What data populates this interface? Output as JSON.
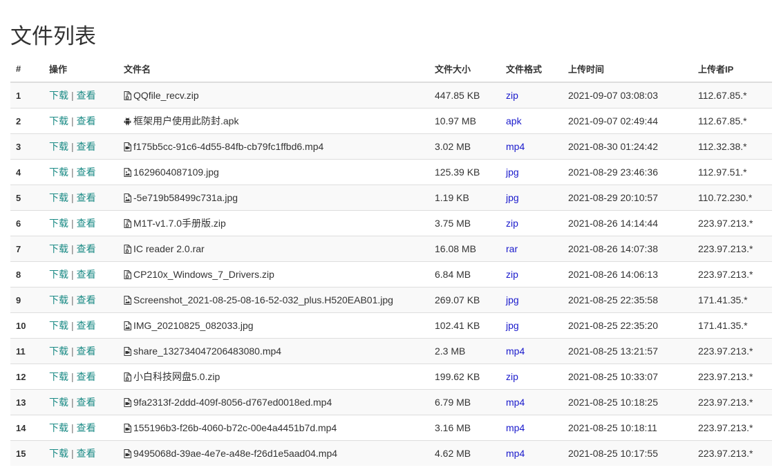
{
  "page_title": "文件列表",
  "columns": [
    "#",
    "操作",
    "文件名",
    "文件大小",
    "文件格式",
    "上传时间",
    "上传者IP"
  ],
  "actions": {
    "download": "下载",
    "view": "查看",
    "separator": "|"
  },
  "rows": [
    {
      "idx": "1",
      "icon": "zip-file-icon",
      "name": "QQfile_recv.zip",
      "size": "447.85 KB",
      "format": "zip",
      "time": "2021-09-07 03:08:03",
      "ip": "112.67.85.*"
    },
    {
      "idx": "2",
      "icon": "android-icon",
      "name": "框架用户使用此防封.apk",
      "size": "10.97 MB",
      "format": "apk",
      "time": "2021-09-07 02:49:44",
      "ip": "112.67.85.*"
    },
    {
      "idx": "3",
      "icon": "video-file-icon",
      "name": "f175b5cc-91c6-4d55-84fb-cb79fc1ffbd6.mp4",
      "size": "3.02 MB",
      "format": "mp4",
      "time": "2021-08-30 01:24:42",
      "ip": "112.32.38.*"
    },
    {
      "idx": "4",
      "icon": "image-file-icon",
      "name": "1629604087109.jpg",
      "size": "125.39 KB",
      "format": "jpg",
      "time": "2021-08-29 23:46:36",
      "ip": "112.97.51.*"
    },
    {
      "idx": "5",
      "icon": "image-file-icon",
      "name": "-5e719b58499c731a.jpg",
      "size": "1.19 KB",
      "format": "jpg",
      "time": "2021-08-29 20:10:57",
      "ip": "110.72.230.*"
    },
    {
      "idx": "6",
      "icon": "zip-file-icon",
      "name": "M1T-v1.7.0手册版.zip",
      "size": "3.75 MB",
      "format": "zip",
      "time": "2021-08-26 14:14:44",
      "ip": "223.97.213.*"
    },
    {
      "idx": "7",
      "icon": "zip-file-icon",
      "name": "IC reader 2.0.rar",
      "size": "16.08 MB",
      "format": "rar",
      "time": "2021-08-26 14:07:38",
      "ip": "223.97.213.*"
    },
    {
      "idx": "8",
      "icon": "zip-file-icon",
      "name": "CP210x_Windows_7_Drivers.zip",
      "size": "6.84 MB",
      "format": "zip",
      "time": "2021-08-26 14:06:13",
      "ip": "223.97.213.*"
    },
    {
      "idx": "9",
      "icon": "image-file-icon",
      "name": "Screenshot_2021-08-25-08-16-52-032_plus.H520EAB01.jpg",
      "size": "269.07 KB",
      "format": "jpg",
      "time": "2021-08-25 22:35:58",
      "ip": "171.41.35.*"
    },
    {
      "idx": "10",
      "icon": "image-file-icon",
      "name": "IMG_20210825_082033.jpg",
      "size": "102.41 KB",
      "format": "jpg",
      "time": "2021-08-25 22:35:20",
      "ip": "171.41.35.*"
    },
    {
      "idx": "11",
      "icon": "video-file-icon",
      "name": "share_132734047206483080.mp4",
      "size": "2.3 MB",
      "format": "mp4",
      "time": "2021-08-25 13:21:57",
      "ip": "223.97.213.*"
    },
    {
      "idx": "12",
      "icon": "zip-file-icon",
      "name": "小白科技网盘5.0.zip",
      "size": "199.62 KB",
      "format": "zip",
      "time": "2021-08-25 10:33:07",
      "ip": "223.97.213.*"
    },
    {
      "idx": "13",
      "icon": "video-file-icon",
      "name": "9fa2313f-2ddd-409f-8056-d767ed0018ed.mp4",
      "size": "6.79 MB",
      "format": "mp4",
      "time": "2021-08-25 10:18:25",
      "ip": "223.97.213.*"
    },
    {
      "idx": "14",
      "icon": "video-file-icon",
      "name": "155196b3-f26b-4060-b72c-00e4a4451b7d.mp4",
      "size": "3.16 MB",
      "format": "mp4",
      "time": "2021-08-25 10:18:11",
      "ip": "223.97.213.*"
    },
    {
      "idx": "15",
      "icon": "video-file-icon",
      "name": "9495068d-39ae-4e7e-a48e-f26d1e5aad04.mp4",
      "size": "4.62 MB",
      "format": "mp4",
      "time": "2021-08-25 10:17:55",
      "ip": "223.97.213.*"
    }
  ],
  "colors": {
    "action_link": "#1a8a85",
    "format_link": "#1a1acc",
    "stripe": "#f9f9f9",
    "border": "#dddddd"
  }
}
